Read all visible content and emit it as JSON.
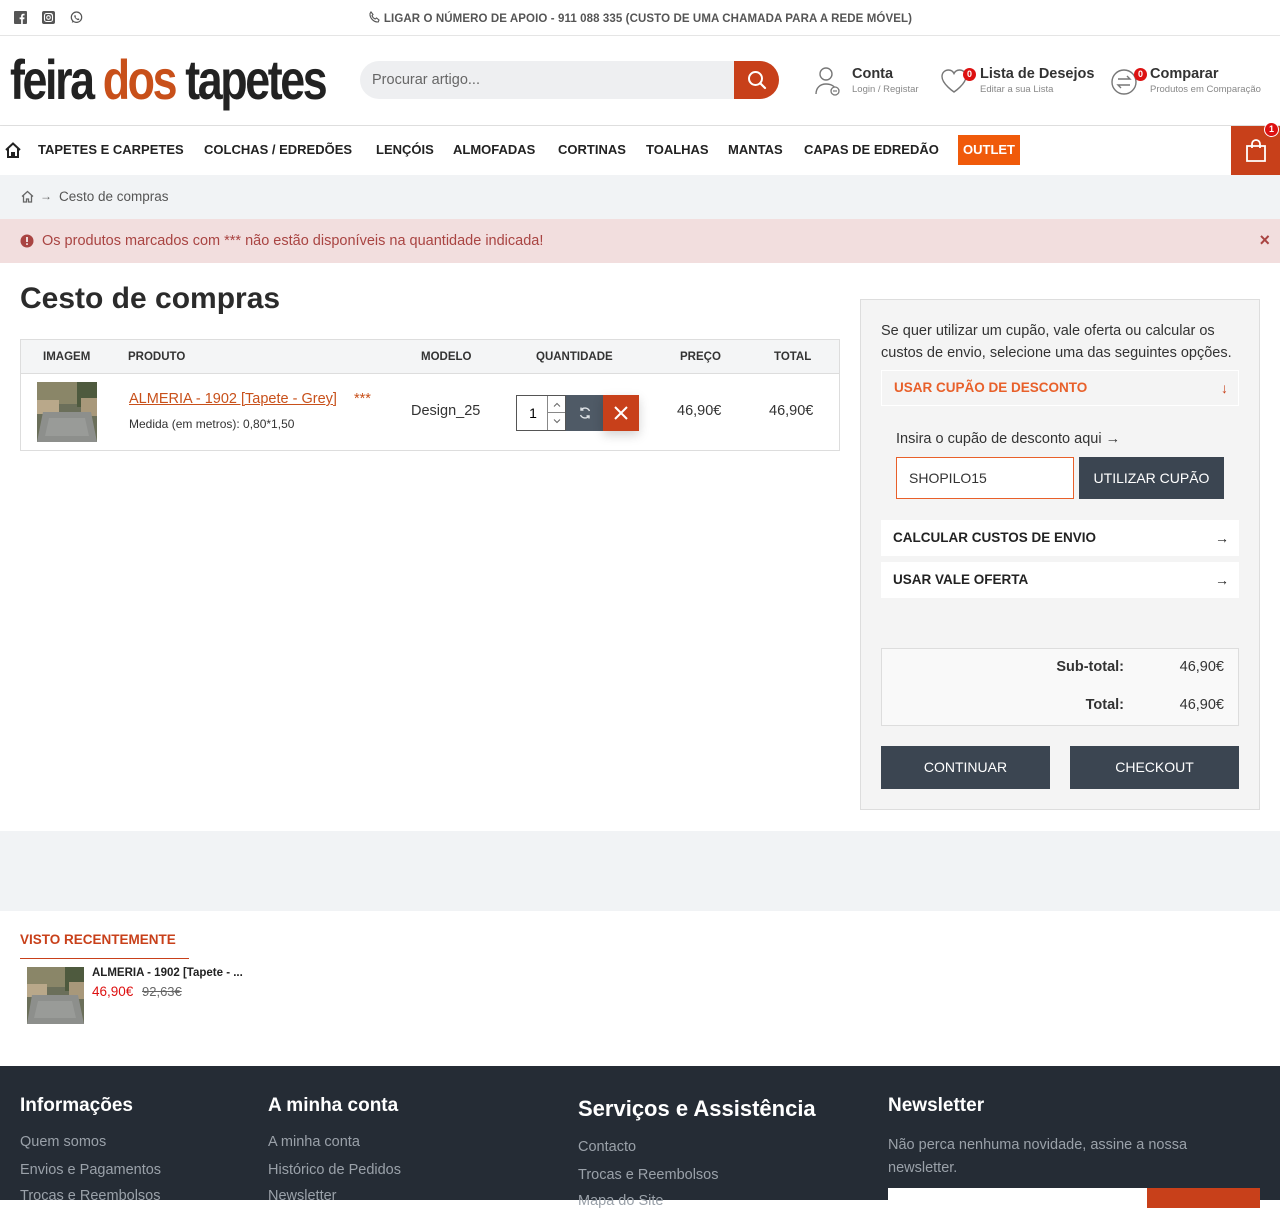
{
  "topbar": {
    "phone_text": "LIGAR O NÚMERO DE APOIO - 911 088 335 (CUSTO DE UMA CHAMADA PARA A REDE MÓVEL)",
    "social": [
      "facebook-icon",
      "instagram-icon",
      "whatsapp-icon"
    ]
  },
  "header": {
    "logo_part1": "feira",
    "logo_part2": "dos",
    "logo_part3": "tapetes",
    "search_placeholder": "Procurar artigo...",
    "account_title": "Conta",
    "account_sub": "Login / Registar",
    "wishlist_title": "Lista de Desejos",
    "wishlist_sub": "Editar a sua Lista",
    "wishlist_count": "0",
    "compare_title": "Comparar",
    "compare_sub": "Produtos em Comparação",
    "compare_count": "0"
  },
  "nav": {
    "items": [
      "TAPETES E CARPETES",
      "COLCHAS / EDREDÕES",
      "LENÇÓIS",
      "ALMOFADAS",
      "CORTINAS",
      "TOALHAS",
      "MANTAS",
      "CAPAS DE EDREDÃO"
    ],
    "outlet": "OUTLET",
    "cart_count": "1"
  },
  "breadcrumb": {
    "current": "Cesto de compras"
  },
  "alert": {
    "text": "Os produtos marcados com *** não estão disponíveis na quantidade indicada!",
    "close": "×"
  },
  "page": {
    "title": "Cesto de compras"
  },
  "cart": {
    "headers": {
      "image": "IMAGEM",
      "product": "PRODUTO",
      "model": "MODELO",
      "quantity": "QUANTIDADE",
      "price": "PREÇO",
      "total": "TOTAL"
    },
    "item": {
      "name": "ALMERIA - 1902 [Tapete - Grey]",
      "stars": "***",
      "option": "Medida (em metros): 0,80*1,50",
      "model": "Design_25",
      "quantity": "1",
      "price": "46,90€",
      "total": "46,90€"
    }
  },
  "sidebar": {
    "intro": "Se quer utilizar um cupão, vale oferta ou calcular os custos de envio, selecione uma das seguintes opções.",
    "coupon_title": "USAR CUPÃO DE DESCONTO",
    "coupon_label": "Insira o cupão de desconto aqui →",
    "coupon_value": "SHOPILO15",
    "coupon_button": "UTILIZAR CUPÃO",
    "shipping_title": "CALCULAR CUSTOS DE ENVIO",
    "voucher_title": "USAR VALE OFERTA",
    "subtotal_label": "Sub-total:",
    "subtotal_value": "46,90€",
    "total_label": "Total:",
    "total_value": "46,90€",
    "continue_button": "CONTINUAR",
    "checkout_button": "CHECKOUT"
  },
  "recent": {
    "heading": "VISTO RECENTEMENTE",
    "name": "ALMERIA - 1902 [Tapete - ...",
    "price": "46,90€",
    "old_price": "92,63€"
  },
  "footer": {
    "col1_title": "Informações",
    "col1_links": [
      "Quem somos",
      "Envios e Pagamentos",
      "Trocas e Reembolsos"
    ],
    "col2_title": "A minha conta",
    "col2_links": [
      "A minha conta",
      "Histórico de Pedidos",
      "Newsletter"
    ],
    "col3_title": "Serviços e Assistência",
    "col3_links": [
      "Contacto",
      "Trocas e Reembolsos",
      "Mapa do Site"
    ],
    "col4_title": "Newsletter",
    "col4_text": "Não perca nenhuma novidade, assine a nossa newsletter."
  },
  "colors": {
    "accent": "#c8401a",
    "dark": "#3b4551",
    "footer": "#252c35",
    "alert_bg": "#f2dede"
  }
}
